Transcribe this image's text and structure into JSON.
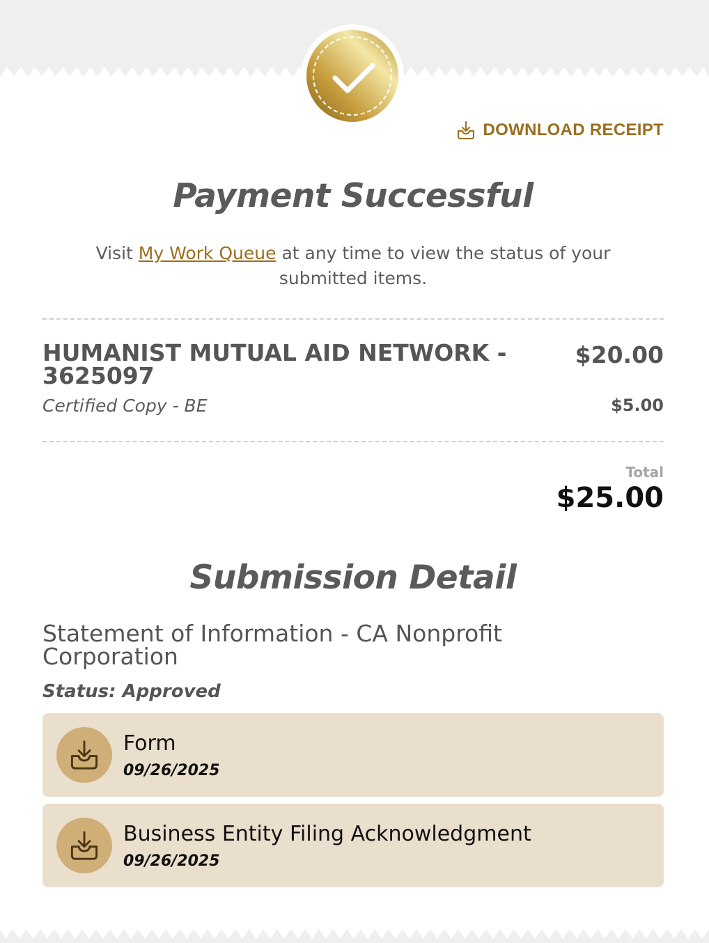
{
  "receipt": {
    "download_label": "DOWNLOAD RECEIPT",
    "title": "Payment Successful",
    "lead_before": "Visit ",
    "lead_link": "My Work Queue",
    "lead_after": " at any time to view the status of your submitted items.",
    "item": {
      "name": "HUMANIST MUTUAL AID NETWORK - 3625097",
      "price": "$20.00",
      "sub_name": "Certified Copy - BE",
      "sub_price": "$5.00"
    },
    "total_label": "Total",
    "total_value": "$25.00"
  },
  "submission": {
    "title": "Submission Detail",
    "filing": "Statement of Information - CA Nonprofit Corporation",
    "status": "Status: Approved",
    "documents": [
      {
        "title": "Form",
        "date": "09/26/2025",
        "icon": "tray-download-icon"
      },
      {
        "title": "Business Entity Filing Acknowledgment",
        "date": "09/26/2025",
        "icon": "tray-download-icon"
      }
    ]
  },
  "colors": {
    "accent": "#9a6e1e",
    "card_bg": "#eadfcc",
    "icon_circle": "#cfae78",
    "page_bg": "#efefef",
    "paper": "#ffffff"
  },
  "icons": {
    "badge": "gold-checkmark-seal-icon",
    "download": "tray-download-icon"
  }
}
